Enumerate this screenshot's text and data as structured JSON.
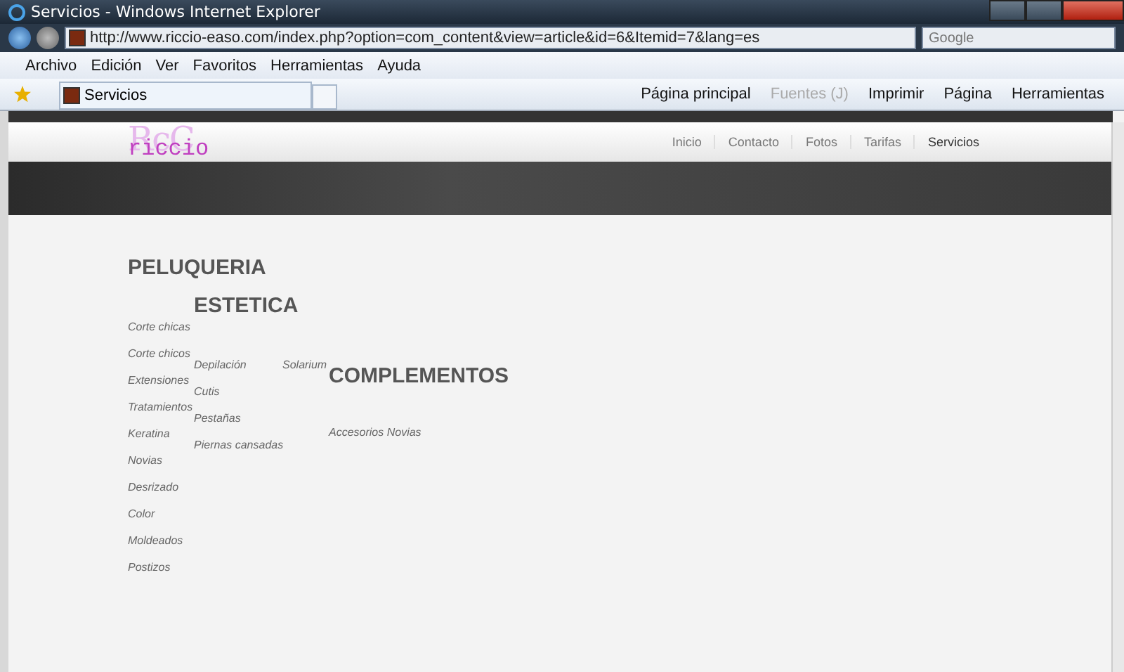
{
  "window": {
    "title": "Servicios - Windows Internet Explorer"
  },
  "address_bar": {
    "url": "http://www.riccio-easo.com/index.php?option=com_content&view=article&id=6&Itemid=7&lang=es",
    "search_placeholder": "Google"
  },
  "menu_bar": [
    "Archivo",
    "Edición",
    "Ver",
    "Favoritos",
    "Herramientas",
    "Ayuda"
  ],
  "tab": {
    "label": "Servicios"
  },
  "command_bar": [
    {
      "label": "Página principal",
      "disabled": false
    },
    {
      "label": "Fuentes (J)",
      "disabled": true
    },
    {
      "label": "Imprimir",
      "disabled": false
    },
    {
      "label": "Página",
      "disabled": false
    },
    {
      "label": "Herramientas",
      "disabled": false
    }
  ],
  "site": {
    "logo_top": "RcC",
    "logo_bottom": "riccio",
    "nav": [
      {
        "label": "Inicio",
        "selected": false
      },
      {
        "label": "Contacto",
        "selected": false
      },
      {
        "label": "Fotos",
        "selected": false
      },
      {
        "label": "Tarifas",
        "selected": false
      },
      {
        "label": "Servicios",
        "selected": true
      }
    ],
    "sections": [
      {
        "heading": "PELUQUERIA",
        "columns": [
          [
            "Corte chicas",
            "Corte  chicos",
            "Extensiones",
            "Tratamientos",
            "Keratina",
            "Novias",
            "Desrizado",
            "Color",
            "Moldeados",
            "Postizos"
          ]
        ]
      },
      {
        "heading": "ESTETICA",
        "columns": [
          [
            "Depilación",
            "Cutis",
            "Pestañas",
            "Piernas cansadas"
          ],
          [
            "Solarium"
          ]
        ]
      },
      {
        "heading": "COMPLEMENTOS",
        "columns": [
          [
            "Accesorios Novias"
          ]
        ]
      }
    ]
  }
}
